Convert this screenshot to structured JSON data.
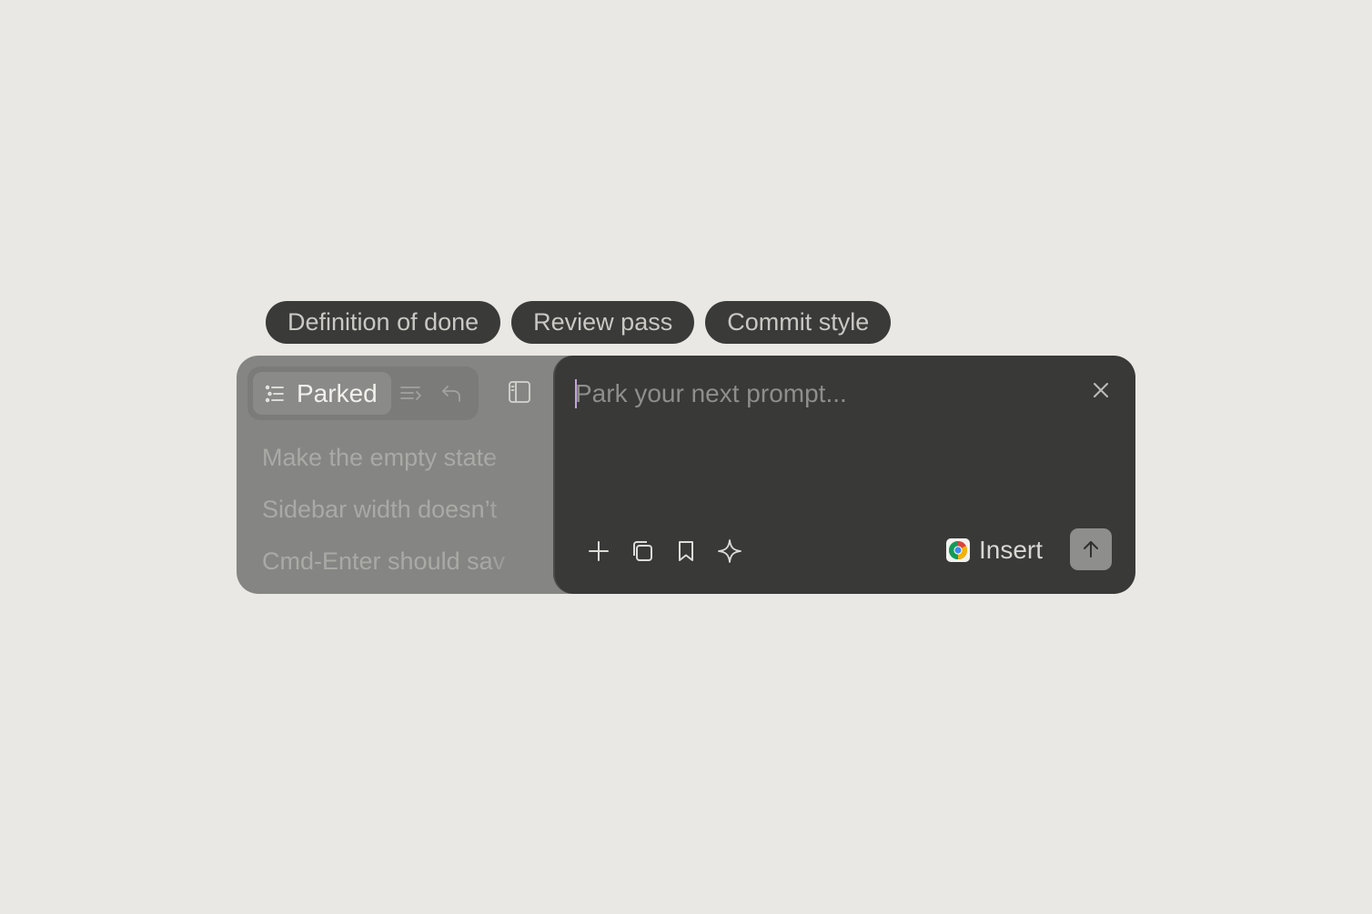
{
  "chips": [
    {
      "label": "Definition of done"
    },
    {
      "label": "Review pass"
    },
    {
      "label": "Commit style"
    }
  ],
  "sidebar": {
    "active_tab": {
      "label": "Parked",
      "icon": "list-icon"
    },
    "toolbar_icons": [
      "sort-list-icon",
      "undo-icon"
    ],
    "toggle_icon": "sidebar-panel-icon",
    "items": [
      {
        "label": "Make the empty state"
      },
      {
        "label": "Sidebar width doesn’t"
      },
      {
        "label": "Cmd-Enter should sav"
      }
    ]
  },
  "composer": {
    "input": {
      "value": "",
      "placeholder": "Park your next prompt..."
    },
    "close_icon": "close-icon",
    "actions": [
      "plus-icon",
      "copy-icon",
      "bookmark-icon",
      "sparkle-icon"
    ],
    "insert": {
      "label": "Insert",
      "icon": "chrome-icon"
    },
    "send_icon": "arrow-up-icon"
  },
  "colors": {
    "background": "#e9e8e4",
    "chip": "#3a3a38",
    "composer": "#393938",
    "sidebar": "#858583",
    "caret": "#c9a0dc"
  }
}
